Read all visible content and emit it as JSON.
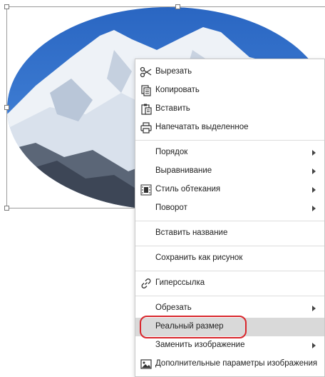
{
  "menu": {
    "cut": "Вырезать",
    "copy": "Копировать",
    "paste": "Вставить",
    "print_selection": "Напечатать выделенное",
    "order": "Порядок",
    "align": "Выравнивание",
    "wrap_style": "Стиль обтекания",
    "rotate": "Поворот",
    "insert_caption": "Вставить название",
    "save_as_picture": "Сохранить как рисунок",
    "hyperlink": "Гиперссылка",
    "crop": "Обрезать",
    "actual_size": "Реальный размер",
    "replace_image": "Заменить изображение",
    "image_settings": "Дополнительные параметры изображения"
  },
  "icons": {
    "cut": "scissors-icon",
    "copy": "copy-icon",
    "paste": "paste-icon",
    "print": "printer-icon",
    "wrap": "text-wrap-icon",
    "link": "link-icon",
    "image": "image-icon"
  },
  "colors": {
    "sky": "#2f72c9",
    "highlight": "#d9d9d9",
    "annotation_ring": "#d9262c"
  }
}
